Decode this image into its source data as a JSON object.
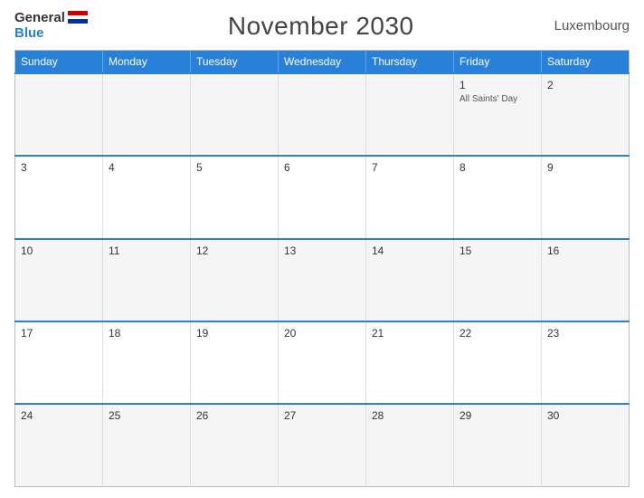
{
  "header": {
    "logo_general": "General",
    "logo_blue": "Blue",
    "title": "November 2030",
    "country": "Luxembourg"
  },
  "days": [
    "Sunday",
    "Monday",
    "Tuesday",
    "Wednesday",
    "Thursday",
    "Friday",
    "Saturday"
  ],
  "weeks": [
    [
      {
        "date": "",
        "holiday": ""
      },
      {
        "date": "",
        "holiday": ""
      },
      {
        "date": "",
        "holiday": ""
      },
      {
        "date": "",
        "holiday": ""
      },
      {
        "date": "",
        "holiday": ""
      },
      {
        "date": "1",
        "holiday": "All Saints' Day"
      },
      {
        "date": "2",
        "holiday": ""
      }
    ],
    [
      {
        "date": "3",
        "holiday": ""
      },
      {
        "date": "4",
        "holiday": ""
      },
      {
        "date": "5",
        "holiday": ""
      },
      {
        "date": "6",
        "holiday": ""
      },
      {
        "date": "7",
        "holiday": ""
      },
      {
        "date": "8",
        "holiday": ""
      },
      {
        "date": "9",
        "holiday": ""
      }
    ],
    [
      {
        "date": "10",
        "holiday": ""
      },
      {
        "date": "11",
        "holiday": ""
      },
      {
        "date": "12",
        "holiday": ""
      },
      {
        "date": "13",
        "holiday": ""
      },
      {
        "date": "14",
        "holiday": ""
      },
      {
        "date": "15",
        "holiday": ""
      },
      {
        "date": "16",
        "holiday": ""
      }
    ],
    [
      {
        "date": "17",
        "holiday": ""
      },
      {
        "date": "18",
        "holiday": ""
      },
      {
        "date": "19",
        "holiday": ""
      },
      {
        "date": "20",
        "holiday": ""
      },
      {
        "date": "21",
        "holiday": ""
      },
      {
        "date": "22",
        "holiday": ""
      },
      {
        "date": "23",
        "holiday": ""
      }
    ],
    [
      {
        "date": "24",
        "holiday": ""
      },
      {
        "date": "25",
        "holiday": ""
      },
      {
        "date": "26",
        "holiday": ""
      },
      {
        "date": "27",
        "holiday": ""
      },
      {
        "date": "28",
        "holiday": ""
      },
      {
        "date": "29",
        "holiday": ""
      },
      {
        "date": "30",
        "holiday": ""
      }
    ]
  ]
}
